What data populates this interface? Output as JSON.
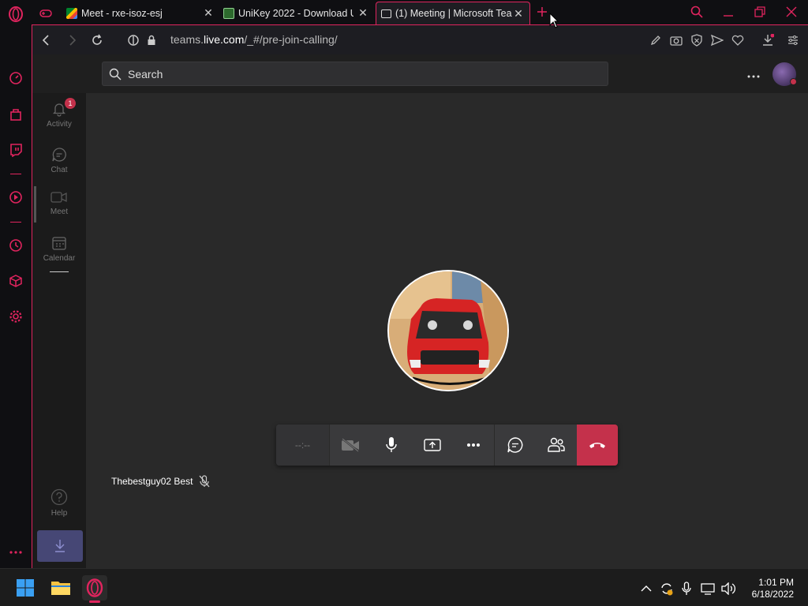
{
  "browser": {
    "tabs": [
      {
        "title": "",
        "icon": "gamepad-icon"
      },
      {
        "title": "Meet - rxe-isoz-esj",
        "icon": "meet-favicon"
      },
      {
        "title": "UniKey 2022 - Download U",
        "icon": "unikey-favicon"
      },
      {
        "title": "(1) Meeting | Microsoft Tea",
        "icon": "teams-favicon"
      }
    ],
    "url_prefix": "teams.",
    "url_domain": "live.com",
    "url_path": "/_#/pre-join-calling/"
  },
  "teams": {
    "search_placeholder": "Search",
    "rail": [
      {
        "label": "Activity",
        "badge": "1"
      },
      {
        "label": "Chat"
      },
      {
        "label": "Meet"
      },
      {
        "label": "Calendar"
      },
      {
        "label": "Help"
      }
    ],
    "call": {
      "timer": "--:--",
      "participant_name": "Thebestguy02 Best"
    }
  },
  "taskbar": {
    "time": "1:01 PM",
    "date": "6/18/2022"
  },
  "colors": {
    "accent": "#e0245e",
    "hangup": "#c4314b",
    "teams_purple": "#464775"
  }
}
